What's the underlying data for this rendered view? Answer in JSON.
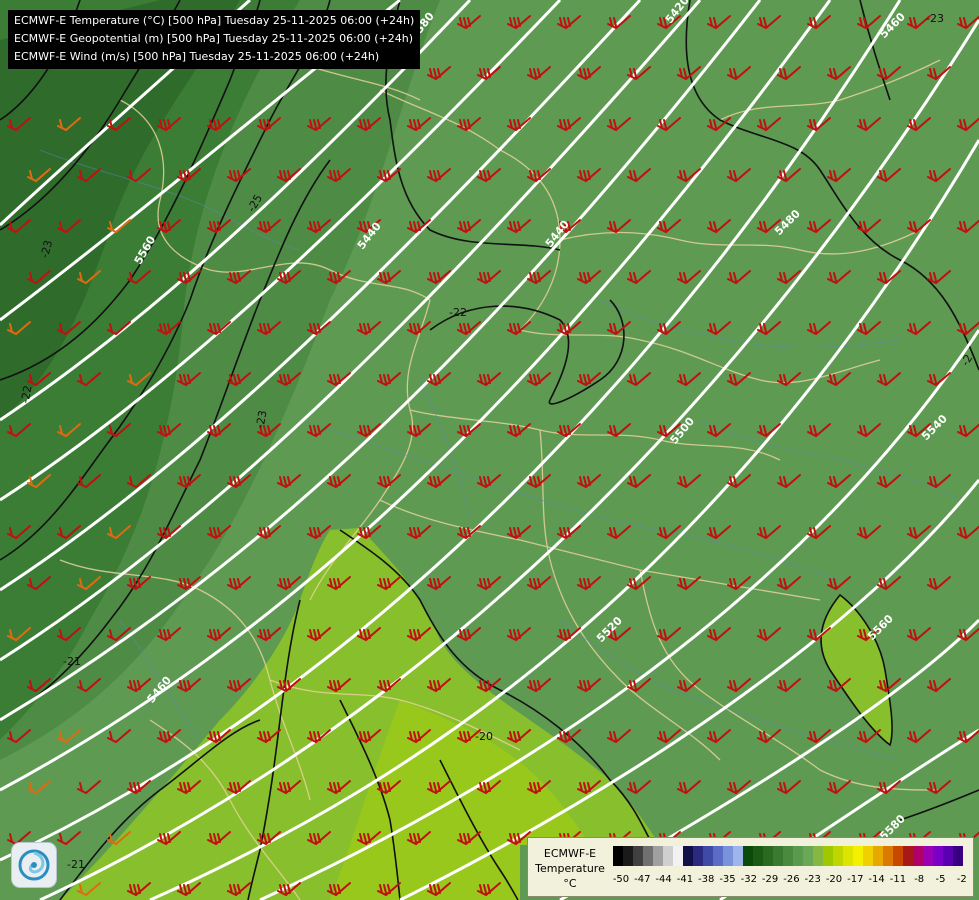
{
  "header": {
    "lines": [
      "ECMWF-E Temperature (°C) [500 hPa] Tuesday 25-11-2025 06:00 (+24h)",
      "ECMWF-E Geopotential (m) [500 hPa] Tuesday 25-11-2025 06:00 (+24h)",
      "ECMWF-E Wind (m/s) [500 hPa] Tuesday 25-11-2025 06:00 (+24h)"
    ]
  },
  "legend": {
    "title_line1": "ECMWF-E",
    "title_line2": "Temperature",
    "unit": "°C",
    "tick_labels": [
      "-50",
      "-47",
      "-44",
      "-41",
      "-38",
      "-35",
      "-32",
      "-29",
      "-26",
      "-23",
      "-20",
      "-17",
      "-14",
      "-11",
      "-8",
      "-5",
      "-2"
    ],
    "colors": [
      "#000000",
      "#1a1a1a",
      "#404040",
      "#707070",
      "#a0a0a0",
      "#cfcfcf",
      "#f2f2f2",
      "#10104a",
      "#2a2a80",
      "#3e4aa6",
      "#5a6cc6",
      "#7a92dc",
      "#9cb6ec",
      "#0a4a0a",
      "#1a5a14",
      "#2a6a20",
      "#3a7a30",
      "#4a8a3e",
      "#5a9a4c",
      "#6aa858",
      "#84b840",
      "#a0c800",
      "#c0d600",
      "#dde400",
      "#f4f000",
      "#f0d000",
      "#e8a800",
      "#dc7a00",
      "#c84800",
      "#a81818",
      "#b0006a",
      "#9c00b4",
      "#7a00c8",
      "#5a00b0",
      "#380080"
    ]
  },
  "map": {
    "geopotential_labels": [
      {
        "text": "5380"
      },
      {
        "text": "5420"
      },
      {
        "text": "5460"
      },
      {
        "text": "5560"
      },
      {
        "text": "5440"
      },
      {
        "text": "5440"
      },
      {
        "text": "5480"
      },
      {
        "text": "5500"
      },
      {
        "text": "5540"
      },
      {
        "text": "5520"
      },
      {
        "text": "5460"
      },
      {
        "text": "5560"
      },
      {
        "text": "5580"
      }
    ],
    "temperature_labels": [
      {
        "text": "-23"
      },
      {
        "text": "-25"
      },
      {
        "text": "-23"
      },
      {
        "text": "-22"
      },
      {
        "text": "-23"
      },
      {
        "text": "-22"
      },
      {
        "text": "-21"
      },
      {
        "text": "-20"
      },
      {
        "text": "-21"
      },
      {
        "text": "-2"
      }
    ]
  }
}
